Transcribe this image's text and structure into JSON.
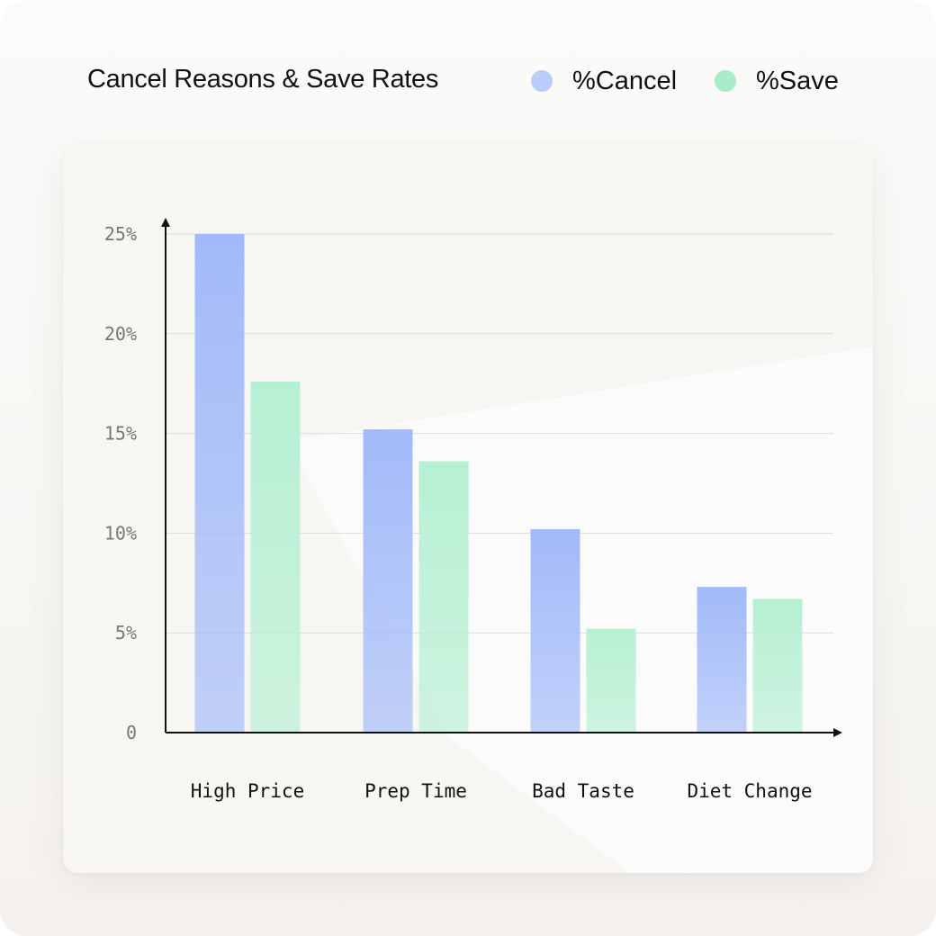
{
  "chart_data": {
    "type": "bar",
    "title": "Cancel Reasons & Save Rates",
    "categories": [
      "High Price",
      "Prep Time",
      "Bad Taste",
      "Diet Change"
    ],
    "series": [
      {
        "name": "%Cancel",
        "values": [
          25,
          15.2,
          10.2,
          7.3
        ],
        "color": "#a2baf9"
      },
      {
        "name": "%Save",
        "values": [
          17.6,
          13.6,
          5.2,
          6.7
        ],
        "color": "#b6f0d3"
      }
    ],
    "yticks": [
      "0",
      "5%",
      "10%",
      "15%",
      "20%",
      "25%"
    ],
    "ylim": [
      0,
      25
    ],
    "grid": true,
    "legend_position": "top-right"
  },
  "colors": {
    "cancel": "#a2baf9",
    "save": "#b6f0d3",
    "cancel_dot": "#b8cdfb",
    "save_dot": "#a8ecc9",
    "axis": "#111111",
    "grid": "#dcdcdc",
    "tick_text": "#777777",
    "category_text": "#111111"
  }
}
